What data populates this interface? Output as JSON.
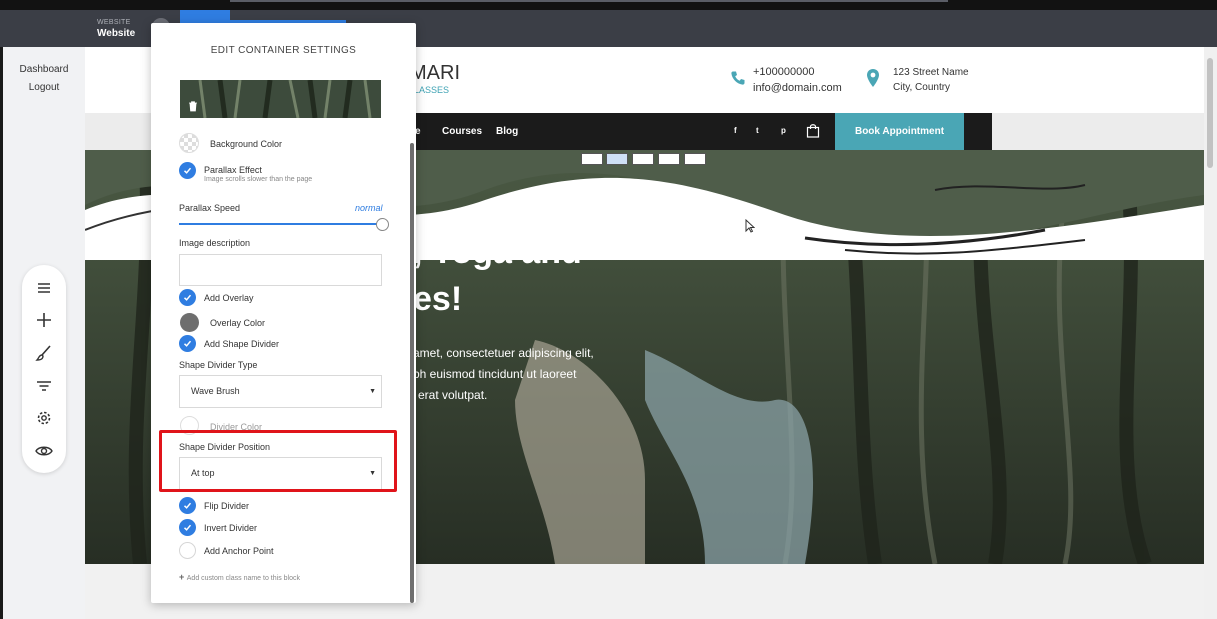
{
  "topbar": {
    "brand_small": "WEBSITE",
    "brand_name": "Website"
  },
  "sidebar": {
    "dashboard": "Dashboard",
    "logout": "Logout"
  },
  "tools": [
    "menu-icon",
    "plus-icon",
    "brush-icon",
    "filter-icon",
    "gear-icon",
    "eye-icon"
  ],
  "site": {
    "logo": "MARI",
    "logo_sub": "LASSES",
    "phone": "+100000000",
    "email": "info@domain.com",
    "address_line1": "123 Street Name",
    "address_line2": "City, Country",
    "nav": {
      "item_partial": "e",
      "courses": "Courses",
      "blog": "Blog"
    },
    "social": {
      "facebook": "f",
      "twitter": "t",
      "pinterest": "p"
    },
    "book_button": "Book Appointment",
    "hero_heading_line1": ", Yoga and",
    "hero_heading_line2": "es!",
    "hero_text_line1": "amet, consectetuer adipiscing elit,",
    "hero_text_line2": "bh euismod tincidunt ut laoreet",
    "hero_text_line3": "erat volutpat."
  },
  "panel": {
    "title": "EDIT CONTAINER SETTINGS",
    "background_color": "Background Color",
    "parallax_effect": "Parallax Effect",
    "parallax_effect_sub": "Image scrolls slower than the page",
    "parallax_speed": "Parallax Speed",
    "parallax_speed_value": "normal",
    "parallax_speed_level": 1.0,
    "image_description": "Image description",
    "image_description_value": "",
    "add_overlay": "Add Overlay",
    "overlay_color": "Overlay Color",
    "add_shape_divider": "Add Shape Divider",
    "shape_divider_type": "Shape Divider Type",
    "shape_divider_type_value": "Wave Brush",
    "divider_color": "Divider Color",
    "shape_divider_position": "Shape Divider Position",
    "shape_divider_position_value": "At top",
    "flip_divider": "Flip Divider",
    "invert_divider": "Invert Divider",
    "add_anchor_point": "Add Anchor Point",
    "custom_class": "Add custom class name to this block"
  },
  "colors": {
    "accent": "#2f7de1",
    "brand_teal": "#4aa6b5",
    "highlight": "#e0141a",
    "overlay": "#6e6e6e"
  }
}
